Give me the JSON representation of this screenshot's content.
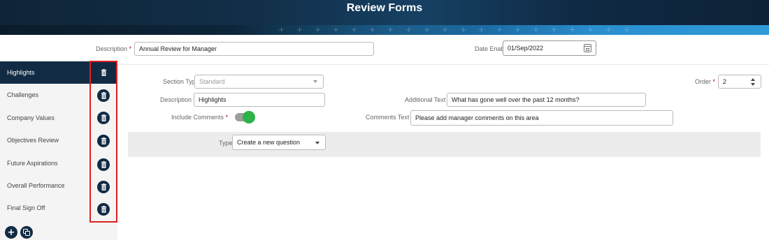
{
  "header": {
    "title": "Review Forms"
  },
  "form": {
    "description_label": "Description",
    "description_value": "Annual Review for Manager",
    "date_label": "Date Enabled",
    "date_value": "01/Sep/2022"
  },
  "sidebar": {
    "items": [
      {
        "label": "Highlights",
        "active": true
      },
      {
        "label": "Challenges"
      },
      {
        "label": "Company Values"
      },
      {
        "label": "Objectives Review"
      },
      {
        "label": "Future Aspirations"
      },
      {
        "label": "Overall Performance"
      },
      {
        "label": "Final Sign Off"
      }
    ]
  },
  "section": {
    "section_type_label": "Section Type",
    "section_type_value": "Standard",
    "order_label": "Order",
    "order_value": "2",
    "description_label": "Description",
    "description_value": "Highlights",
    "additional_text_label": "Additional Text",
    "additional_text_value": "What has gone well over the past 12 months?",
    "include_comments_label": "Include Comments",
    "comments_text_label": "Comments Text",
    "comments_text_value": "Please add manager comments on this area",
    "type_label": "Type",
    "type_value": "Create a new question"
  },
  "required_mark": "*",
  "colors": {
    "navy": "#122b44",
    "toggle_on": "#2db34a",
    "highlight_box": "#e02020"
  },
  "icons": {
    "delete": "trash-icon",
    "add": "plus-icon",
    "copy": "copy-icon",
    "calendar": "calendar-icon"
  }
}
